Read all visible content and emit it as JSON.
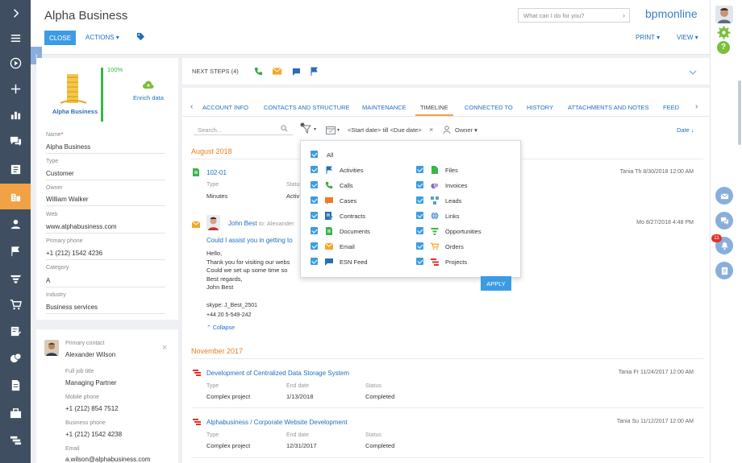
{
  "header": {
    "title": "Alpha Business",
    "close_label": "CLOSE",
    "actions_label": "ACTIONS ▾",
    "print_label": "PRINT ▾",
    "view_label": "VIEW ▾",
    "search_placeholder": "What can I do for you?",
    "logo": "bpmonline"
  },
  "account": {
    "logo_text": "Alpha Business",
    "completeness": "100%",
    "enrich_label": "Enrich data",
    "fields": [
      {
        "label": "Name",
        "value": "Alpha Business",
        "required": true
      },
      {
        "label": "Type",
        "value": "Customer"
      },
      {
        "label": "Owner",
        "value": "William Walker"
      },
      {
        "label": "Web",
        "value": "www.alphabusiness.com"
      },
      {
        "label": "Primary phone",
        "value": "+1 (212) 1542 4236"
      },
      {
        "label": "Category",
        "value": "A"
      },
      {
        "label": "Industry",
        "value": "Business services"
      }
    ]
  },
  "contact": {
    "primary_label": "Primary contact",
    "name": "Alexander Wilson",
    "job_label": "Full job title",
    "job": "Managing Partner",
    "mobile_label": "Mobile phone",
    "mobile": "+1 (212) 854 7512",
    "business_label": "Business phone",
    "business": "+1 (212) 1542 4238",
    "email_label": "Email",
    "email": "a.wilson@alphabusiness.com"
  },
  "next_steps": {
    "label": "NEXT STEPS (4)"
  },
  "tabs": [
    "ACCOUNT INFO",
    "CONTACTS AND STRUCTURE",
    "MAINTENANCE",
    "TIMELINE",
    "CONNECTED TO",
    "HISTORY",
    "ATTACHMENTS AND NOTES",
    "FEED"
  ],
  "active_tab": "TIMELINE",
  "filters": {
    "search_placeholder": "Search...",
    "date_range": "<Start date> till <Due date>",
    "owner": "Owner",
    "sort": "Date ↓"
  },
  "timeline": {
    "month1": "August 2018",
    "item1": {
      "title": "102-01",
      "type_label": "Type",
      "type": "Minutes",
      "status_label": "Status",
      "status": "Activ",
      "meta": "Tania  Th 8/30/2018 12:00 AM"
    },
    "email": {
      "from": "John Best",
      "to": "to: Alexander",
      "meta": "Mo 8/27/2018 4:48 PM",
      "subject": "Could I assist you in getting to",
      "body": [
        "Hello,",
        "Thank you for visiting our webs",
        "Could we set up some time so",
        "Best regards,",
        "John Best"
      ],
      "sig1": "skype: J_Best_2501",
      "sig2": "+44 20 5-549-242",
      "collapse": "Collapse"
    },
    "month2": "November 2017",
    "project1": {
      "title": "Development of Centralized Data Storage System",
      "meta": "Tania  Fr 11/24/2017 12:00 AM",
      "l1": "Type",
      "v1": "Complex project",
      "l2": "End date",
      "v2": "1/13/2018",
      "l3": "Status",
      "v3": "Completed"
    },
    "project2": {
      "title": "Alphabusiness / Corporate Website Development",
      "meta": "Tania  Su 11/12/2017 12:00 AM",
      "l1": "Type",
      "v1": "Complex project",
      "l2": "End date",
      "v2": "12/31/2017",
      "l3": "Status",
      "v3": "Completed"
    }
  },
  "dropdown": {
    "all": "All",
    "left": [
      "Activities",
      "Calls",
      "Cases",
      "Contracts",
      "Documents",
      "Email",
      "ESN Feed"
    ],
    "right": [
      "Files",
      "Invoices",
      "Leads",
      "Links",
      "Opportunities",
      "Orders",
      "Projects"
    ],
    "apply": "APPLY"
  },
  "notifications_count": "11",
  "colors": {
    "nav": "#3f4f61",
    "accent": "#3c9ce3",
    "orange": "#e67e22",
    "active_nav": "#f1a244"
  }
}
